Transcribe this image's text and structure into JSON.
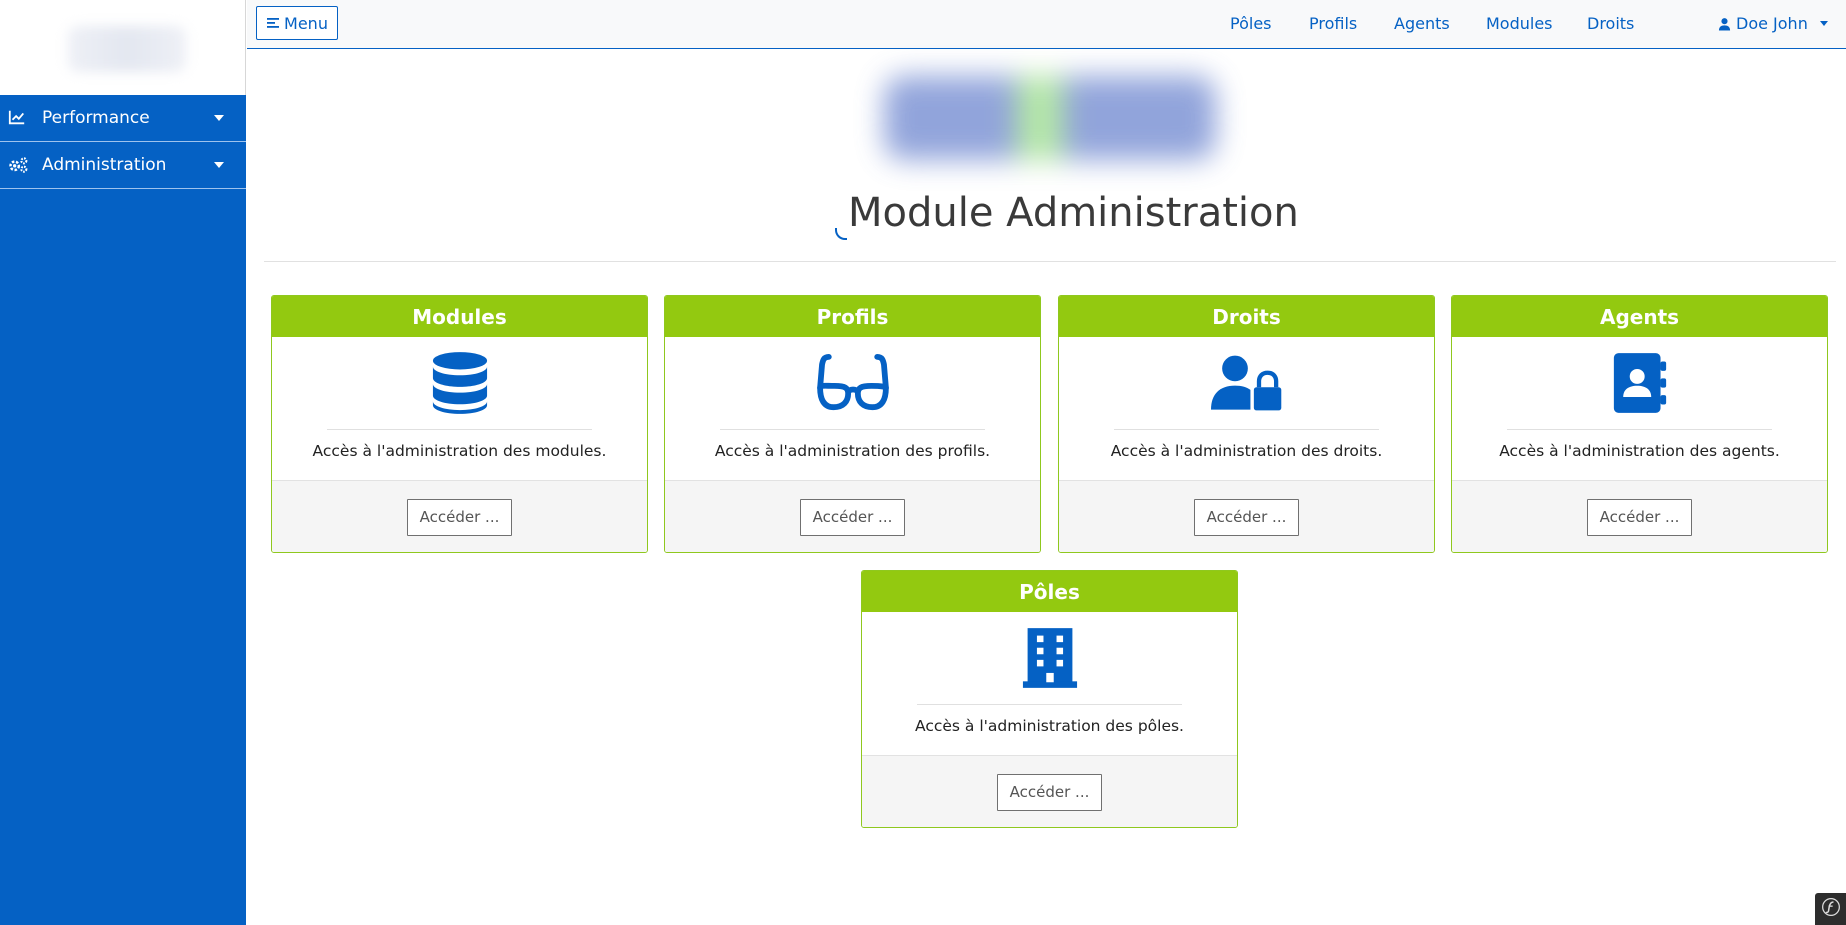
{
  "sidebar": {
    "items": [
      {
        "label": "Performance",
        "icon": "chart-line-icon"
      },
      {
        "label": "Administration",
        "icon": "cogs-icon"
      }
    ]
  },
  "topnav": {
    "menu_label": "Menu",
    "links": [
      "Pôles",
      "Profils",
      "Agents",
      "Modules",
      "Droits"
    ],
    "user_name": "Doe John"
  },
  "page": {
    "title": "Module Administration"
  },
  "cards": [
    {
      "title": "Modules",
      "icon": "database-icon",
      "text": "Accès à l'administration des modules.",
      "button": "Accéder ..."
    },
    {
      "title": "Profils",
      "icon": "glasses-icon",
      "text": "Accès à l'administration des profils.",
      "button": "Accéder ..."
    },
    {
      "title": "Droits",
      "icon": "user-lock-icon",
      "text": "Accès à l'administration des droits.",
      "button": "Accéder ..."
    },
    {
      "title": "Agents",
      "icon": "address-book-icon",
      "text": "Accès à l'administration des agents.",
      "button": "Accéder ..."
    },
    {
      "title": "Pôles",
      "icon": "building-icon",
      "text": "Accès à l'administration des pôles.",
      "button": "Accéder ..."
    }
  ],
  "colors": {
    "primary": "#0561c4",
    "accent": "#93c910"
  }
}
